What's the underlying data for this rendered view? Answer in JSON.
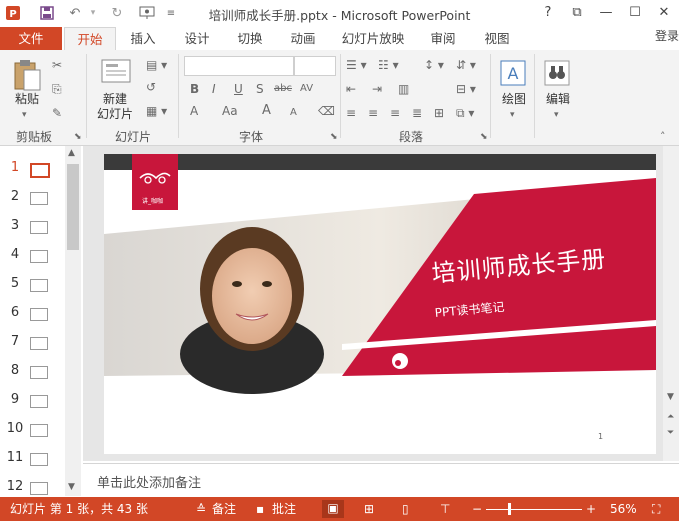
{
  "window": {
    "title": "培训师成长手册.pptx - Microsoft PowerPoint",
    "help": "?",
    "buttons": [
      "?",
      "⧉",
      "—",
      "☐",
      "✕"
    ]
  },
  "quick_access": [
    "save-icon",
    "undo-icon",
    "redo-icon",
    "slideshow-icon",
    "customize-icon"
  ],
  "tabs": {
    "file": "文件",
    "items": [
      "开始",
      "插入",
      "设计",
      "切换",
      "动画",
      "幻灯片放映",
      "审阅",
      "视图"
    ],
    "active": "开始",
    "login": "登录"
  },
  "ribbon": {
    "clipboard": {
      "paste": "粘贴",
      "label": "剪贴板"
    },
    "slides": {
      "new_slide": "新建\n幻灯片",
      "new_line1": "新建",
      "new_line2": "幻灯片",
      "label": "幻灯片"
    },
    "font": {
      "label": "字体",
      "bold": "B",
      "italic": "I",
      "underline": "U",
      "shadow": "S",
      "strike": "abc",
      "spacing": "AV",
      "fontcolor": "A",
      "case": "Aa",
      "grow": "A",
      "shrink": "A"
    },
    "paragraph": {
      "label": "段落"
    },
    "drawing": {
      "label": "绘图"
    },
    "editing": {
      "label": "编辑"
    }
  },
  "thumbnails": [
    {
      "num": "1",
      "selected": true
    },
    {
      "num": "2",
      "selected": false
    },
    {
      "num": "3",
      "selected": false
    },
    {
      "num": "4",
      "selected": false
    },
    {
      "num": "5",
      "selected": false
    },
    {
      "num": "6",
      "selected": false
    },
    {
      "num": "7",
      "selected": false
    },
    {
      "num": "8",
      "selected": false
    },
    {
      "num": "9",
      "selected": false
    },
    {
      "num": "10",
      "selected": false
    },
    {
      "num": "11",
      "selected": false
    },
    {
      "num": "12",
      "selected": false
    }
  ],
  "slide": {
    "title": "培训师成长手册",
    "subtitle": "PPT读书笔记",
    "page_number": "1",
    "logo_text": "讲_咖咖",
    "accent": "#c8163b"
  },
  "notes": {
    "placeholder": "单击此处添加备注"
  },
  "status": {
    "slide_info": "幻灯片 第 1 张，共 43 张",
    "notes_btn": "备注",
    "comments_btn": "批注",
    "zoom": "56%"
  },
  "colors": {
    "brand": "#d24726",
    "slide_accent": "#c8163b"
  }
}
